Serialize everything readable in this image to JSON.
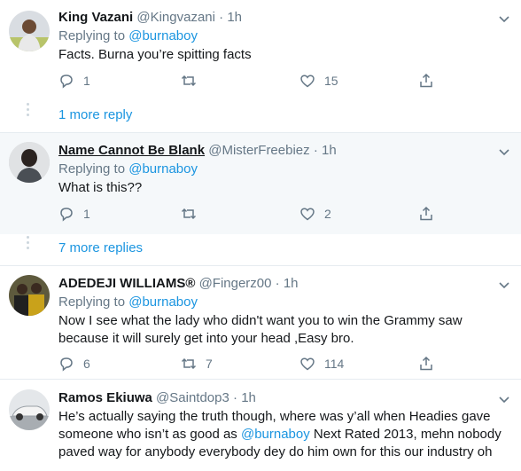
{
  "tweets": [
    {
      "name": "King Vazani",
      "handle": "@Kingvazani",
      "time": "1h",
      "replying_label": "Replying to",
      "replying_to": "@burnaboy",
      "text": "Facts. Burna you’re spitting facts",
      "reply_count": "1",
      "retweet_count": "",
      "like_count": "15"
    },
    {
      "name": "Name Cannot Be Blank",
      "handle": "@MisterFreebiez",
      "time": "1h",
      "replying_label": "Replying to",
      "replying_to": "@burnaboy",
      "text": "What is this??",
      "reply_count": "1",
      "retweet_count": "",
      "like_count": "2"
    },
    {
      "name": "ADEDEJI WILLIAMS®",
      "handle": "@Fingerz00",
      "time": "1h",
      "replying_label": "Replying to",
      "replying_to": "@burnaboy",
      "text_line1": "Now I see what  the lady who didn't want you to win the Grammy saw",
      "text_line2": "because it will surely get into your head ,Easy bro.",
      "reply_count": "6",
      "retweet_count": "7",
      "like_count": "114"
    },
    {
      "name": "Ramos Ekiuwa",
      "handle": "@Saintdop3",
      "time": "1h",
      "text_line1": "He’s actually saying the truth though, where was y’all when Headies gave",
      "text_line2_pre": "someone who isn’t as good as ",
      "text_line2_mention": "@burnaboy",
      "text_line2_post": " Next Rated 2013, mehn nobody",
      "text_line3": "paved way for anybody everybody dey do him own for this our industry oh"
    }
  ],
  "more_replies": [
    "1 more reply",
    "7 more replies"
  ],
  "colors": {
    "accent": "#1b95e0",
    "secondary_text": "#657786",
    "hover_bg": "#f5f8fa",
    "divider": "#e6ecf0"
  }
}
